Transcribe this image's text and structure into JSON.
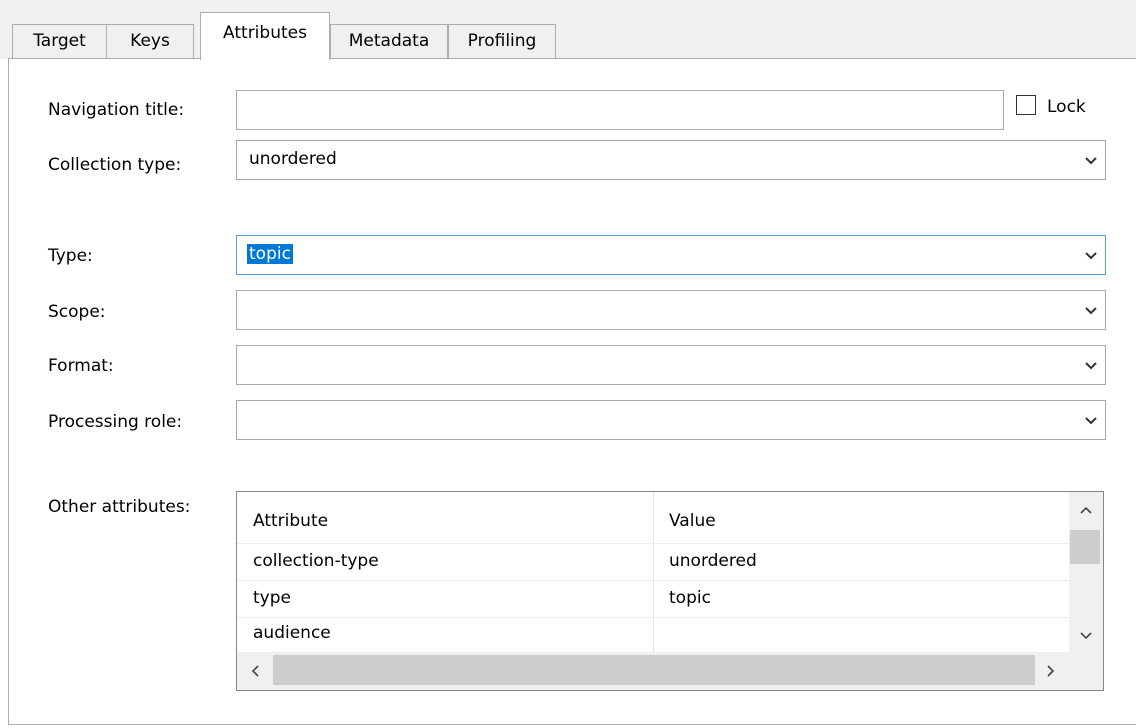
{
  "tabs": [
    {
      "label": "Target",
      "active": false
    },
    {
      "label": "Keys",
      "active": false
    },
    {
      "label": "Attributes",
      "active": true
    },
    {
      "label": "Metadata",
      "active": false
    },
    {
      "label": "Profiling",
      "active": false
    }
  ],
  "form": {
    "navigation_title": {
      "label": "Navigation title:",
      "value": ""
    },
    "lock": {
      "label": "Lock",
      "checked": false
    },
    "collection_type": {
      "label": "Collection type:",
      "value": "unordered"
    },
    "type": {
      "label": "Type:",
      "value": "topic"
    },
    "scope": {
      "label": "Scope:",
      "value": ""
    },
    "format": {
      "label": "Format:",
      "value": ""
    },
    "processing_role": {
      "label": "Processing role:",
      "value": ""
    }
  },
  "other_attributes": {
    "label": "Other attributes:",
    "columns": [
      "Attribute",
      "Value"
    ],
    "rows": [
      [
        "collection-type",
        "unordered"
      ],
      [
        "type",
        "topic"
      ],
      [
        "audience",
        ""
      ]
    ]
  },
  "colors": {
    "selection": "#0078d7",
    "focus_border": "#569de5"
  },
  "icons": {
    "dropdown": "chevron-down-icon",
    "scroll_up": "chevron-up-icon",
    "scroll_down": "chevron-down-icon",
    "scroll_left": "chevron-left-icon",
    "scroll_right": "chevron-right-icon"
  }
}
